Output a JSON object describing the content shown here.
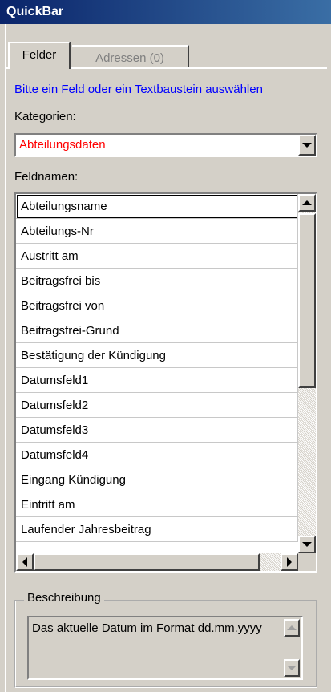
{
  "window": {
    "title": "QuickBar"
  },
  "tabs": [
    {
      "label": "Felder",
      "active": true
    },
    {
      "label": "Adressen (0)",
      "active": false
    }
  ],
  "hint": "Bitte ein Feld oder ein Textbaustein auswählen",
  "kategorien": {
    "label": "Kategorien:",
    "selected": "Abteilungsdaten",
    "value_color": "#ff0000"
  },
  "feldnamen": {
    "label": "Feldnamen:",
    "items": [
      "Abteilungsname",
      "Abteilungs-Nr",
      "Austritt am",
      "Beitragsfrei bis",
      "Beitragsfrei von",
      "Beitragsfrei-Grund",
      "Bestätigung der Kündigung",
      "Datumsfeld1",
      "Datumsfeld2",
      "Datumsfeld3",
      "Datumsfeld4",
      "Eingang Kündigung",
      "Eintritt am",
      "Laufender Jahresbeitrag"
    ],
    "focused_index": 0
  },
  "beschreibung": {
    "label": "Beschreibung",
    "text": "Das aktuelle Datum im Format dd.mm.yyyy"
  },
  "colors": {
    "hint": "#0000ff",
    "titlebar": "#0a246a",
    "face": "#d4d0c8"
  },
  "icons": [
    "dropdown-arrow-icon",
    "scroll-up-icon",
    "scroll-down-icon",
    "scroll-left-icon",
    "scroll-right-icon"
  ]
}
